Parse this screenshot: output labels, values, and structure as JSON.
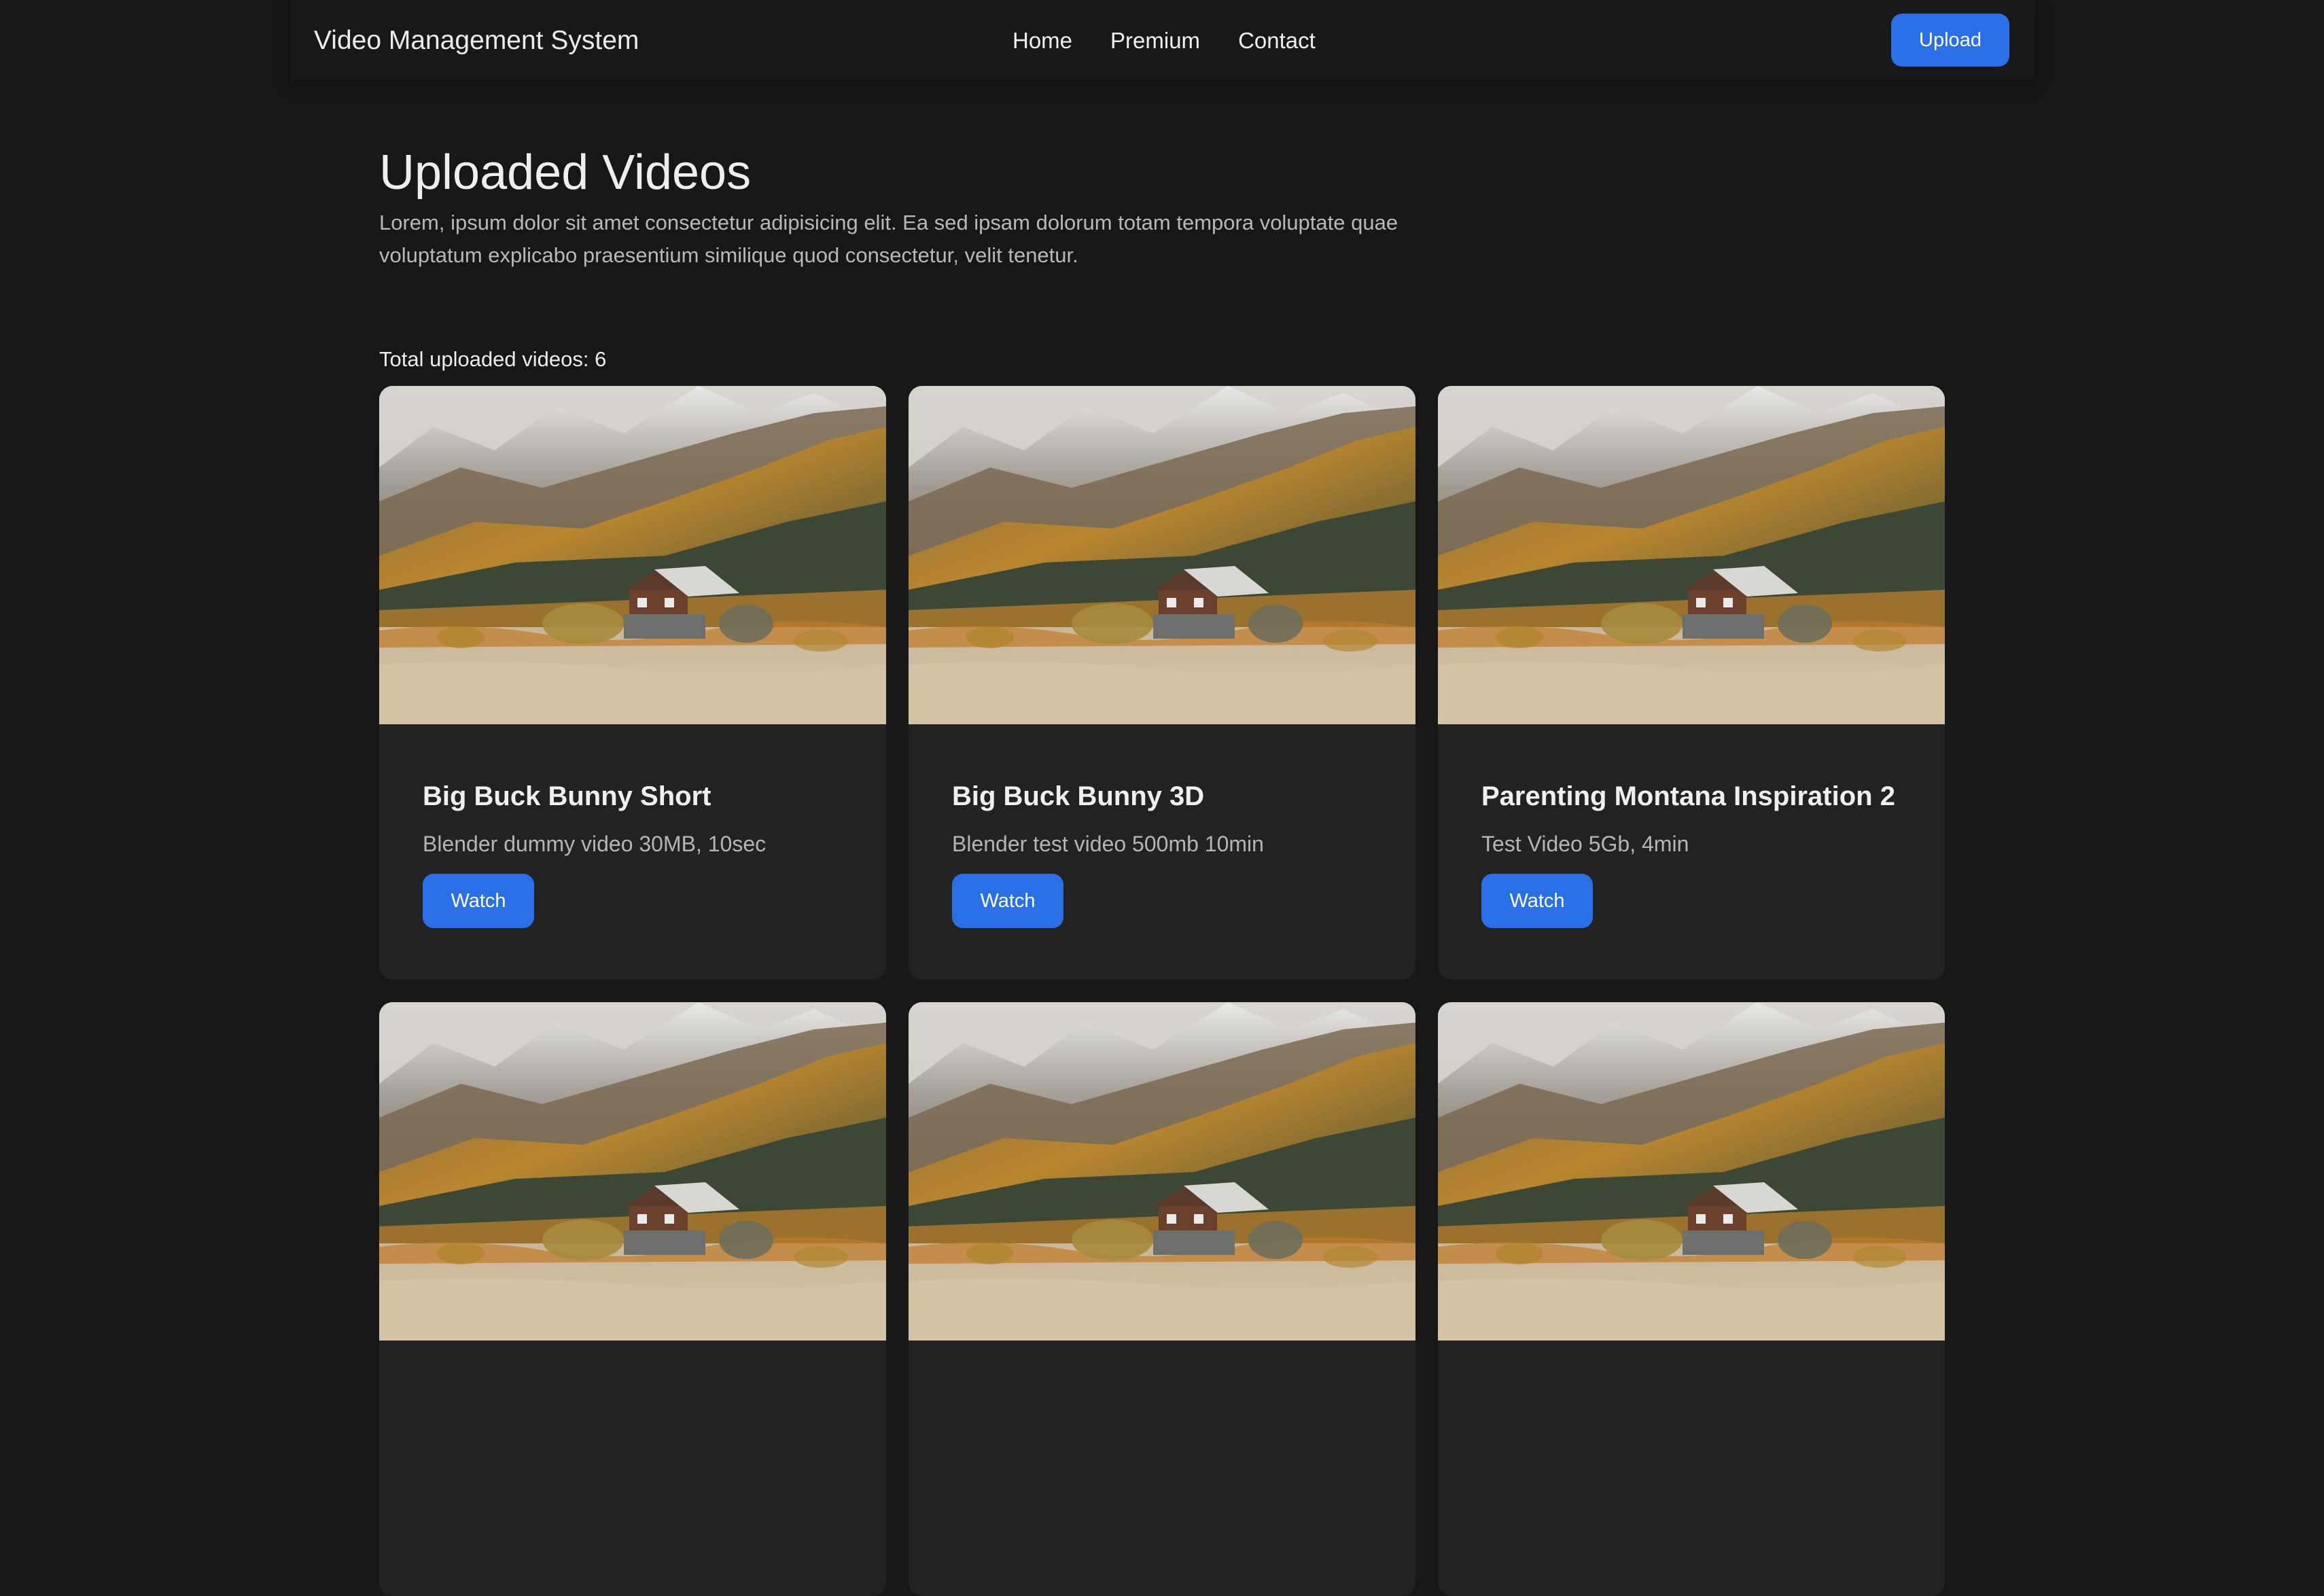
{
  "navbar": {
    "brand": "Video Management System",
    "links": [
      "Home",
      "Premium",
      "Contact"
    ],
    "upload_label": "Upload"
  },
  "main": {
    "title": "Uploaded Videos",
    "description": "Lorem, ipsum dolor sit amet consectetur adipisicing elit. Ea sed ipsam dolorum totam tempora voluptate quae voluptatum explicabo praesentium similique quod consectetur, velit tenetur.",
    "count_label": "Total uploaded videos: 6"
  },
  "videos": [
    {
      "title": "Big Buck Bunny Short",
      "subtitle": "Blender dummy video 30MB, 10sec",
      "action": "Watch"
    },
    {
      "title": "Big Buck Bunny 3D",
      "subtitle": "Blender test video 500mb 10min",
      "action": "Watch"
    },
    {
      "title": "Parenting Montana Inspiration 2",
      "subtitle": "Test Video 5Gb, 4min",
      "action": "Watch"
    },
    {
      "title": "",
      "subtitle": "",
      "action": ""
    },
    {
      "title": "",
      "subtitle": "",
      "action": ""
    },
    {
      "title": "",
      "subtitle": "",
      "action": ""
    }
  ],
  "colors": {
    "background": "#171717",
    "card": "#222222",
    "accent": "#2b6fe6"
  }
}
